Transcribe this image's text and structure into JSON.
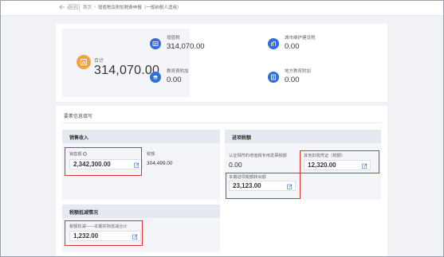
{
  "nav": {
    "back_label": "返回",
    "breadcrumb": [
      "首页",
      "增值税及附加税费申报（一般纳税人适用）"
    ]
  },
  "summary": {
    "total_label": "合计",
    "total_value": "314,070.00",
    "items": [
      {
        "label": "增值税",
        "value": "314,070.00",
        "icon": "vat-icon"
      },
      {
        "label": "城市维护建设税",
        "value": "0.00",
        "icon": "city-tax-icon"
      },
      {
        "label": "教育费附加",
        "value": "0.00",
        "icon": "education-fee-icon"
      },
      {
        "label": "地方教育附加",
        "value": "0.00",
        "icon": "local-education-icon"
      }
    ]
  },
  "form": {
    "title": "要素信息填写",
    "sales": {
      "heading": "销售收入",
      "sales_amount_label": "销售额",
      "sales_amount_value": "2,342,300.00",
      "tax_label": "税额",
      "tax_value": "304,499.00"
    },
    "input_tax": {
      "heading": "进项税额",
      "certified_label": "认证相符的增值税专用发票税额",
      "certified_value": "0.00",
      "other_label": "其他扣税凭证（税额）",
      "other_value": "12,320.00",
      "transfer_label": "本期进项税额转出额",
      "transfer_value": "23,123.00"
    },
    "reduction": {
      "heading": "税额抵减情况",
      "label": "税额抵减——本期实际抵减合计",
      "value": "1,232.00"
    }
  },
  "colors": {
    "highlight": "#e0332e",
    "accent_blue": "#2f6ed8",
    "total_icon": "#f1a444"
  }
}
